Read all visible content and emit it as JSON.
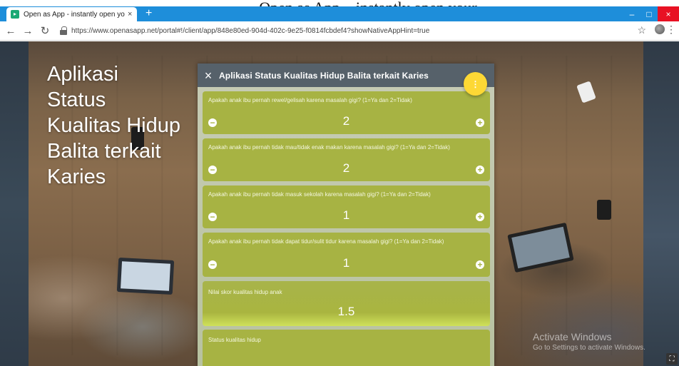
{
  "caption": {
    "text": "Open as App – instantly open your"
  },
  "browser": {
    "tab_title": "Open as App - instantly open yo",
    "tab_close": "×",
    "new_tab": "+",
    "url": "https://www.openasapp.net/portal#!/client/app/848e80ed-904d-402c-9e25-f0814fcbdef4?showNativeAppHint=true",
    "win_min": "–",
    "win_max": "□",
    "win_close": "×"
  },
  "hero": {
    "title": "Aplikasi Status Kualitas Hidup Balita terkait Karies"
  },
  "app": {
    "title": "Aplikasi Status Kualitas Hidup Balita terkait Karies",
    "close_label": "×",
    "fab_label": "⋮",
    "questions": [
      {
        "label": "Apakah anak ibu pernah rewel/gelisah karena masalah gigi? (1=Ya dan 2=Tidak)",
        "value": "2"
      },
      {
        "label": "Apakah anak ibu pernah tidak mau/tidak enak makan karena masalah gigi? (1=Ya dan 2=Tidak)",
        "value": "2"
      },
      {
        "label": "Apakah anak ibu pernah tidak masuk sekolah karena masalah gigi? (1=Ya dan 2=Tidak)",
        "value": "1"
      },
      {
        "label": "Apakah anak ibu pernah tidak dapat tidur/sulit tidur karena masalah gigi? (1=Ya dan 2=Tidak)",
        "value": "1"
      }
    ],
    "score": {
      "label": "Nilai skor kualitas hidup anak",
      "value": "1.5"
    },
    "status": {
      "label": "Status kualitas hidup"
    }
  },
  "watermark": {
    "title": "Activate Windows",
    "subtitle": "Go to Settings to activate Windows."
  },
  "colors": {
    "card": "#a7b343",
    "header": "#56616a",
    "fab": "#fdd835",
    "tabbar": "#1e8eda"
  }
}
